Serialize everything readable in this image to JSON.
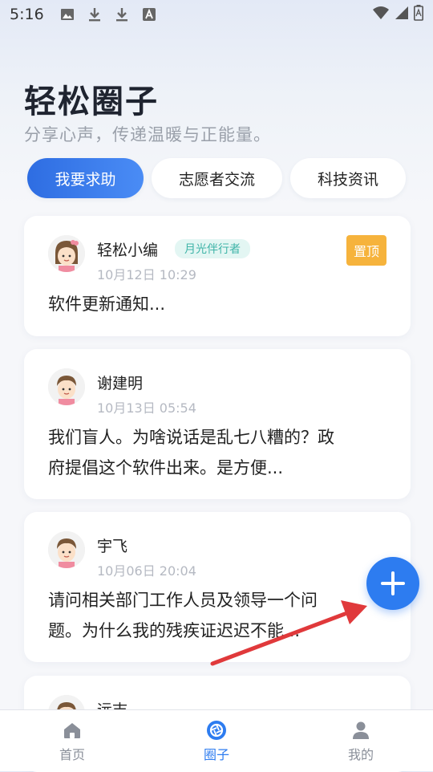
{
  "status_bar": {
    "time": "5:16"
  },
  "header": {
    "title": "轻松圈子",
    "subtitle": "分享心声，传递温暖与正能量。"
  },
  "tabs": [
    {
      "label": "我要求助",
      "active": true
    },
    {
      "label": "志愿者交流",
      "active": false
    },
    {
      "label": "科技资讯",
      "active": false
    }
  ],
  "posts": [
    {
      "author": "轻松小编",
      "badge": "月光伴行者",
      "time": "10月12日 10:29",
      "pin": "置顶",
      "lines": [
        "软件更新通知..."
      ]
    },
    {
      "author": "谢建明",
      "time": "10月13日 05:54",
      "lines": [
        "我们盲人。为啥说话是乱七八糟的？政",
        "府提倡这个软件出来。是方便..."
      ]
    },
    {
      "author": "宇飞",
      "time": "10月06日 20:04",
      "lines": [
        "请问相关部门工作人员及领导一个问",
        "题。为什么我的残疾证迟迟不能..."
      ]
    },
    {
      "author": "远志"
    }
  ],
  "bottom_nav": [
    {
      "label": "首页",
      "icon": "home-icon",
      "active": false
    },
    {
      "label": "圈子",
      "icon": "circle-icon",
      "active": true
    },
    {
      "label": "我的",
      "icon": "person-icon",
      "active": false
    }
  ],
  "colors": {
    "accent": "#2d7cf0",
    "pin": "#f6b33c",
    "badge_text": "#3fb4a8",
    "annotation_arrow": "#e0393b"
  }
}
